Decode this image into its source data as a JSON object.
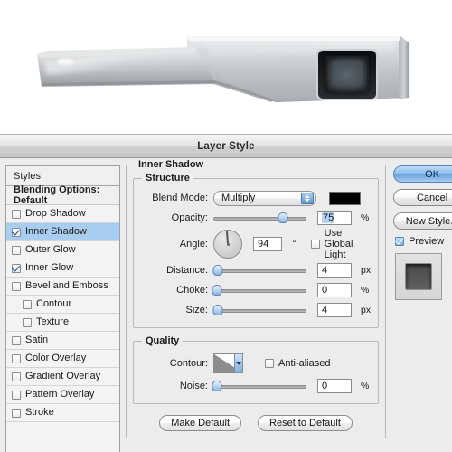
{
  "artwork": {
    "name": "brushed-metal-bracket-render",
    "description": "Brushed aluminum angled bracket with recessed dark square inset",
    "colors": {
      "metal_light": "#e8e9ea",
      "metal_mid": "#b9bcbe",
      "metal_dark": "#8d9094",
      "inset_dark": "#1c1c1e",
      "inset_inner": "#3a4044",
      "background": "#ffffff"
    }
  },
  "window": {
    "title": "Layer Style"
  },
  "styles_panel": {
    "header": "Styles",
    "blending_options": "Blending Options: Default",
    "effects": [
      {
        "label": "Drop Shadow",
        "checked": false,
        "selected": false,
        "sub": false
      },
      {
        "label": "Inner Shadow",
        "checked": true,
        "selected": true,
        "sub": false
      },
      {
        "label": "Outer Glow",
        "checked": false,
        "selected": false,
        "sub": false
      },
      {
        "label": "Inner Glow",
        "checked": true,
        "selected": false,
        "sub": false
      },
      {
        "label": "Bevel and Emboss",
        "checked": false,
        "selected": false,
        "sub": false
      },
      {
        "label": "Contour",
        "checked": false,
        "selected": false,
        "sub": true
      },
      {
        "label": "Texture",
        "checked": false,
        "selected": false,
        "sub": true
      },
      {
        "label": "Satin",
        "checked": false,
        "selected": false,
        "sub": false
      },
      {
        "label": "Color Overlay",
        "checked": false,
        "selected": false,
        "sub": false
      },
      {
        "label": "Gradient Overlay",
        "checked": false,
        "selected": false,
        "sub": false
      },
      {
        "label": "Pattern Overlay",
        "checked": false,
        "selected": false,
        "sub": false
      },
      {
        "label": "Stroke",
        "checked": false,
        "selected": false,
        "sub": false
      }
    ]
  },
  "panel": {
    "title": "Inner Shadow",
    "structure": {
      "legend": "Structure",
      "blend_mode": {
        "label": "Blend Mode:",
        "value": "Multiply",
        "swatch_color": "#000000"
      },
      "opacity": {
        "label": "Opacity:",
        "value": "75",
        "unit": "%",
        "percent": 75
      },
      "angle": {
        "label": "Angle:",
        "value": "94",
        "unit": "°",
        "degrees": 94
      },
      "use_global_light": {
        "label": "Use Global Light",
        "checked": false
      },
      "distance": {
        "label": "Distance:",
        "value": "4",
        "unit": "px",
        "percent": 5
      },
      "choke": {
        "label": "Choke:",
        "value": "0",
        "unit": "%",
        "percent": 3
      },
      "size": {
        "label": "Size:",
        "value": "4",
        "unit": "px",
        "percent": 5
      }
    },
    "quality": {
      "legend": "Quality",
      "contour": {
        "label": "Contour:",
        "shape": "linear"
      },
      "anti_aliased": {
        "label": "Anti-aliased",
        "checked": false
      },
      "noise": {
        "label": "Noise:",
        "value": "0",
        "unit": "%",
        "percent": 3
      }
    },
    "buttons": {
      "make_default": "Make Default",
      "reset_to_default": "Reset to Default"
    }
  },
  "right": {
    "ok": "OK",
    "cancel": "Cancel",
    "new_style": "New Style...",
    "preview": {
      "label": "Preview",
      "checked": true
    }
  }
}
